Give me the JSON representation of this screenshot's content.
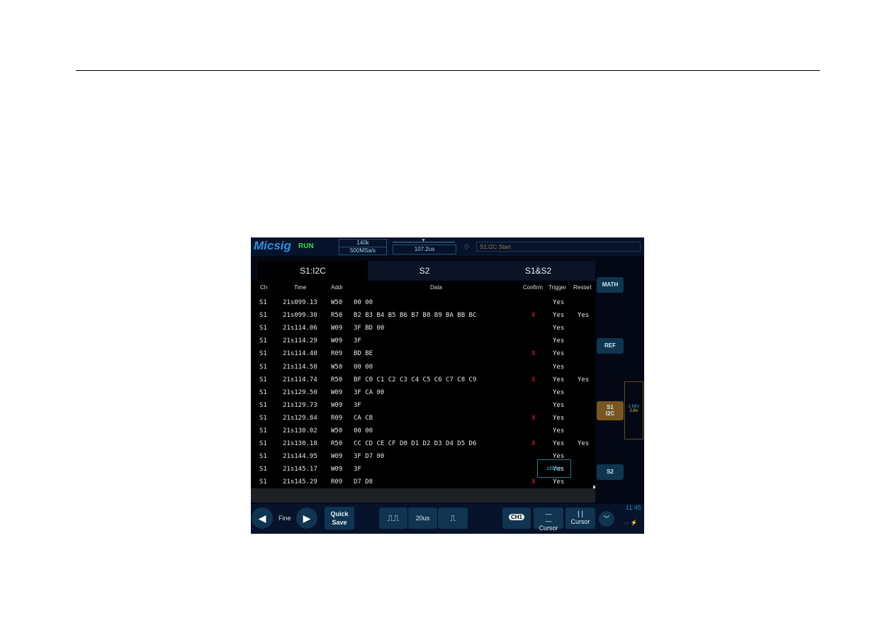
{
  "brand": "Micsig",
  "status": "RUN",
  "top": {
    "memory": "140k",
    "sample_rate": "500MSa/s",
    "time_offset": "107.2us",
    "trigger_text": "S1:I2C Start"
  },
  "tabs": [
    {
      "label": "S1:I2C",
      "active": true
    },
    {
      "label": "S2"
    },
    {
      "label": "S1&S2"
    }
  ],
  "columns": {
    "ch": "Ch",
    "time": "Time",
    "addr": "Addr",
    "data": "Data",
    "confirm": "Confirm",
    "trigger": "Trigger",
    "restart": "Restart"
  },
  "rows": [
    {
      "ch": "S1",
      "time": "21s099.13",
      "addr": "W50",
      "data": "00 00",
      "confirm": "",
      "trigger": "Yes",
      "restart": ""
    },
    {
      "ch": "S1",
      "time": "21s099.30",
      "addr": "R50",
      "data": "B2 B3 B4 B5 B6 B7 B8 B9 BA BB BC",
      "confirm": "X",
      "trigger": "Yes",
      "restart": "Yes"
    },
    {
      "ch": "S1",
      "time": "21s114.06",
      "addr": "W09",
      "data": "3F BD 00",
      "confirm": "",
      "trigger": "Yes",
      "restart": ""
    },
    {
      "ch": "S1",
      "time": "21s114.29",
      "addr": "W09",
      "data": "3F",
      "confirm": "",
      "trigger": "Yes",
      "restart": ""
    },
    {
      "ch": "S1",
      "time": "21s114.40",
      "addr": "R09",
      "data": "BD BE",
      "confirm": "X",
      "trigger": "Yes",
      "restart": ""
    },
    {
      "ch": "S1",
      "time": "21s114.58",
      "addr": "W50",
      "data": "00 00",
      "confirm": "",
      "trigger": "Yes",
      "restart": ""
    },
    {
      "ch": "S1",
      "time": "21s114.74",
      "addr": "R50",
      "data": "BF C0 C1 C2 C3 C4 C5 C6 C7 C8 C9",
      "confirm": "X",
      "trigger": "Yes",
      "restart": "Yes"
    },
    {
      "ch": "S1",
      "time": "21s129.50",
      "addr": "W09",
      "data": "3F CA 00",
      "confirm": "",
      "trigger": "Yes",
      "restart": ""
    },
    {
      "ch": "S1",
      "time": "21s129.73",
      "addr": "W09",
      "data": "3F",
      "confirm": "",
      "trigger": "Yes",
      "restart": ""
    },
    {
      "ch": "S1",
      "time": "21s129.84",
      "addr": "R09",
      "data": "CA CB",
      "confirm": "X",
      "trigger": "Yes",
      "restart": ""
    },
    {
      "ch": "S1",
      "time": "21s130.02",
      "addr": "W50",
      "data": "00 00",
      "confirm": "",
      "trigger": "Yes",
      "restart": ""
    },
    {
      "ch": "S1",
      "time": "21s130.18",
      "addr": "R50",
      "data": "CC CD CE CF D0 D1 D2 D3 D4 D5 D6",
      "confirm": "X",
      "trigger": "Yes",
      "restart": "Yes"
    },
    {
      "ch": "S1",
      "time": "21s144.95",
      "addr": "W09",
      "data": "3F D7 00",
      "confirm": "",
      "trigger": "Yes",
      "restart": ""
    },
    {
      "ch": "S1",
      "time": "21s145.17",
      "addr": "W09",
      "data": "3F",
      "confirm": "",
      "trigger": "Yes",
      "restart": ""
    },
    {
      "ch": "S1",
      "time": "21s145.29",
      "addr": "R09",
      "data": "D7 D8",
      "confirm": "X",
      "trigger": "Yes",
      "restart": ""
    }
  ],
  "close_label": "close",
  "side": {
    "math": "MATH",
    "ref": "REF",
    "s1_line1": "S1",
    "s1_line2": "I2C",
    "s2": "S2",
    "level1": "2.68V",
    "level2": "2.6V"
  },
  "bottom": {
    "fine": "Fine",
    "quick_save_1": "Quick",
    "quick_save_2": "Save",
    "timebase": "20us",
    "ch_label": "CH1",
    "cursor_h": "Cursor",
    "cursor_v": "Cursor",
    "clock": "11:45"
  },
  "colors": {
    "accent": "#2f8fe0",
    "run": "#3ad83a",
    "s1_badge": "#7a5520",
    "confirm_x": "#e03030"
  }
}
